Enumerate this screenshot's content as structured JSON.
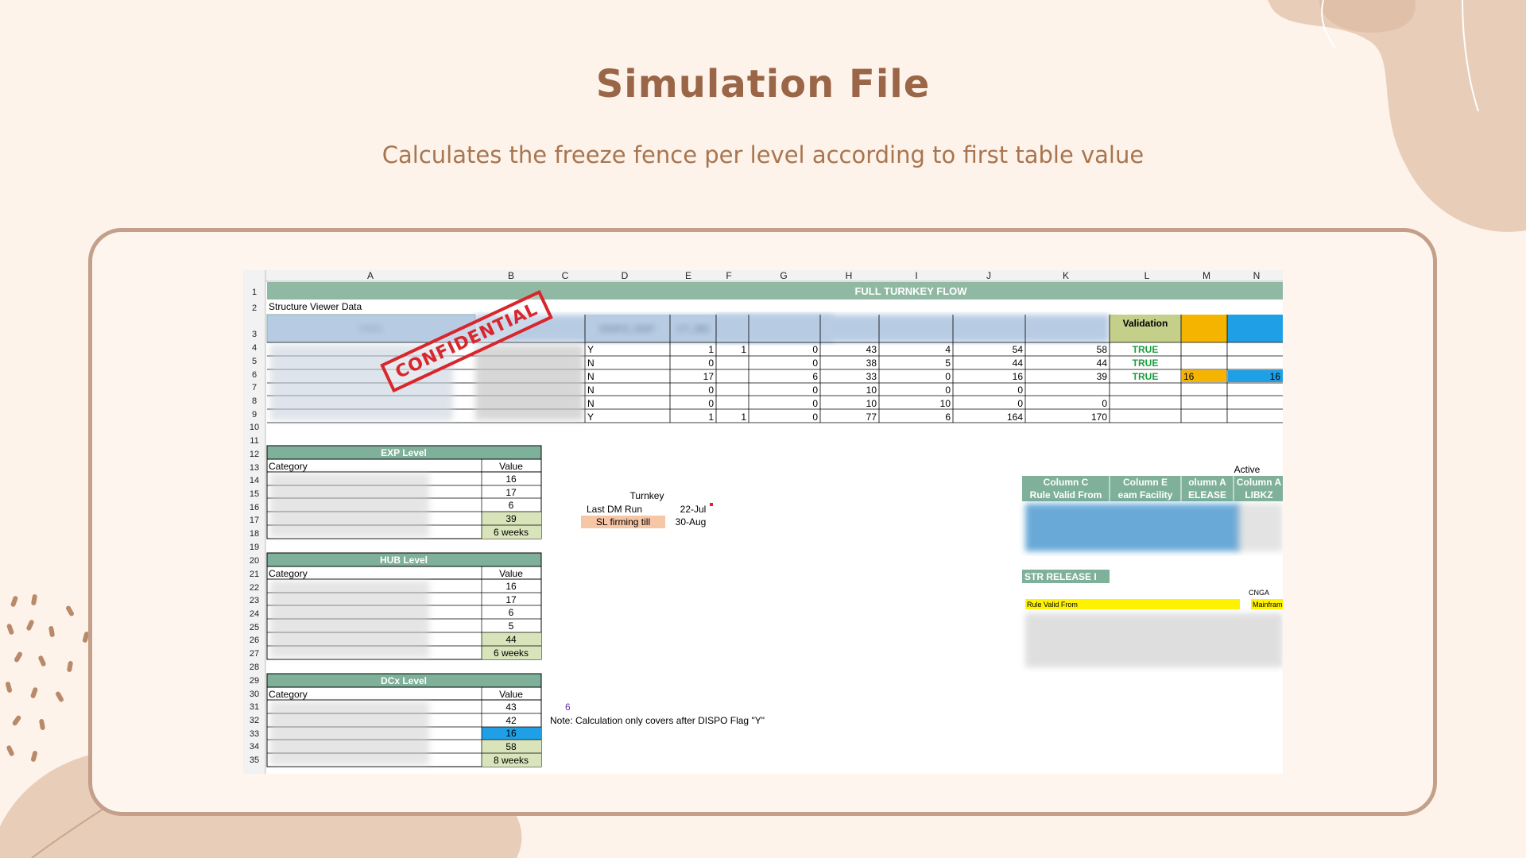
{
  "slide": {
    "title": "Simulation File",
    "subtitle": "Calculates the freeze fence per level according to first table value"
  },
  "sheet": {
    "columns": [
      "A",
      "B",
      "C",
      "D",
      "E",
      "F",
      "G",
      "H",
      "I",
      "J",
      "K",
      "L",
      "M",
      "N"
    ],
    "row_numbers": [
      "1",
      "2",
      "3",
      "4",
      "5",
      "6",
      "7",
      "8",
      "9",
      "10",
      "11",
      "12",
      "13",
      "14",
      "15",
      "16",
      "17",
      "18",
      "19",
      "20",
      "21",
      "22",
      "23",
      "24",
      "25",
      "26",
      "27",
      "28",
      "29",
      "30",
      "31",
      "32",
      "33",
      "34",
      "35"
    ],
    "banner": "FULL TURNKEY FLOW",
    "structure_label": "Structure Viewer Data",
    "headers": {
      "tree": "TREE",
      "dispo": "DISPO_RAP",
      "ct": "CT_MD",
      "validation": "Validation"
    },
    "top_rows": [
      {
        "d": "Y",
        "e": "1",
        "f": "1",
        "g": "0",
        "h": "43",
        "i": "4",
        "j": "54",
        "k": "58",
        "l": "TRUE",
        "m": "",
        "n": ""
      },
      {
        "d": "N",
        "e": "0",
        "f": "",
        "g": "0",
        "h": "38",
        "i": "5",
        "j": "44",
        "k": "44",
        "l": "TRUE",
        "m": "",
        "n": ""
      },
      {
        "d": "N",
        "e": "17",
        "f": "",
        "g": "6",
        "h": "33",
        "i": "0",
        "j": "16",
        "k": "39",
        "l": "TRUE",
        "m": "16",
        "n": "16"
      },
      {
        "d": "N",
        "e": "0",
        "f": "",
        "g": "0",
        "h": "10",
        "i": "0",
        "j": "0",
        "k": "",
        "l": "",
        "m": "",
        "n": ""
      },
      {
        "d": "N",
        "e": "0",
        "f": "",
        "g": "0",
        "h": "10",
        "i": "10",
        "j": "0",
        "k": "0",
        "l": "",
        "m": "",
        "n": ""
      },
      {
        "d": "Y",
        "e": "1",
        "f": "1",
        "g": "0",
        "h": "77",
        "i": "6",
        "j": "164",
        "k": "170",
        "l": "",
        "m": "",
        "n": ""
      }
    ],
    "confidential": "CONFIDENTIAL",
    "exp": {
      "title": "EXP Level",
      "category": "Category",
      "value": "Value",
      "values": [
        "16",
        "17",
        "6",
        "39",
        "6 weeks"
      ]
    },
    "hub": {
      "title": "HUB Level",
      "category": "Category",
      "value": "Value",
      "values": [
        "16",
        "17",
        "6",
        "5",
        "44",
        "6 weeks"
      ]
    },
    "dcx": {
      "title": "DCx Level",
      "category": "Category",
      "value": "Value",
      "values": [
        "43",
        "42",
        "16",
        "58",
        "8 weeks"
      ]
    },
    "turnkey": {
      "label": "Turnkey",
      "last_dm_run_label": "Last DM Run",
      "last_dm_run_value": "22-Jul",
      "sl_firming_label": "SL firming till",
      "sl_firming_value": "30-Aug"
    },
    "note_number": "6",
    "note": "Note: Calculation only covers after DISPO Flag \"Y\"",
    "right_panel": {
      "active": "Active",
      "col_headers": [
        "Column C",
        "Column E",
        "olumn A",
        "Column A"
      ],
      "sub_headers": [
        "Rule Valid From",
        "eam Facility",
        "ELEASE",
        "LIBKZ"
      ],
      "str_release": "STR RELEASE I",
      "cnga": "CNGA",
      "rule_valid_from": "Rule Valid From",
      "mainframe": "Mainfram"
    }
  },
  "colors": {
    "background": "#fdf3ea",
    "title": "#9a6647",
    "subtitle": "#a8754f",
    "frame": "#c49f8a",
    "banner": "#8fb9a3",
    "header_blue": "#b7cce3",
    "level_header": "#7fb09a",
    "value_green": "#d9e4bb",
    "highlight_blue": "#1fa0e6",
    "highlight_orange": "#f4b400",
    "salmon": "#f6c6a6",
    "true_text": "#1a9e3c"
  }
}
